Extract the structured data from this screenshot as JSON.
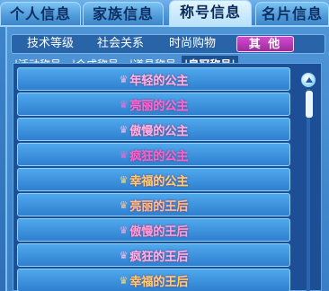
{
  "top_tabs": [
    {
      "label": "个人信息"
    },
    {
      "label": "家族信息"
    },
    {
      "label": "称号信息"
    },
    {
      "label": "名片信息"
    }
  ],
  "top_active": "称号信息",
  "category_tabs": [
    {
      "label": "技术等级"
    },
    {
      "label": "社会关系"
    },
    {
      "label": "时尚购物"
    },
    {
      "label": "其 他"
    }
  ],
  "sub_tabs": [
    {
      "label": "活动称号"
    },
    {
      "label": "合成称号"
    },
    {
      "label": "道具称号"
    },
    {
      "label": "皇冠称号"
    }
  ],
  "titles": [
    {
      "label": "年轻的公主",
      "color": "#ffb3e6"
    },
    {
      "label": "亮丽的公主",
      "color": "#ff66d6"
    },
    {
      "label": "傲慢的公主",
      "color": "#ffb3e6"
    },
    {
      "label": "疯狂的公主",
      "color": "#ff5fcf"
    },
    {
      "label": "幸福的公主",
      "color": "#ffd36b"
    },
    {
      "label": "亮丽的王后",
      "color": "#ffc08a"
    },
    {
      "label": "傲慢的王后",
      "color": "#ff9ed8"
    },
    {
      "label": "疯狂的王后",
      "color": "#ffb3e6"
    },
    {
      "label": "幸福的王后",
      "color": "#ffd36b"
    }
  ],
  "crown_icon": "crown-icon"
}
